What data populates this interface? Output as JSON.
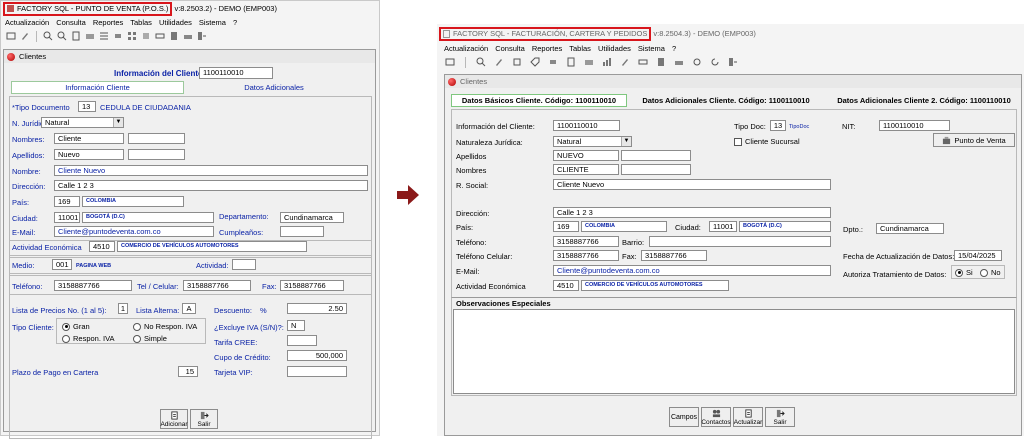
{
  "left": {
    "app_title": "FACTORY SQL - PUNTO DE VENTA (P.O.S.)",
    "version": "v:8.2503.2) - DEMO (EMP003)",
    "menu": [
      "Actualización",
      "Consulta",
      "Reportes",
      "Tablas",
      "Utilidades",
      "Sistema",
      "?"
    ],
    "child_title": "Clientes",
    "info_cliente_label": "Información del Cliente:",
    "info_cliente_value": "1100110010",
    "tabs": [
      "Información Cliente",
      "Datos Adicionales"
    ],
    "tipo_doc_label": "*Tipo Documento",
    "tipo_doc_value": "13",
    "tipo_doc_desc": "CEDULA DE CIUDADANIA",
    "n_juridica_label": "N. Jurídica:",
    "n_juridica_value": "Natural",
    "nombres_label": "Nombres:",
    "nombres_value": "Cliente",
    "apellidos_label": "Apellidos:",
    "apellidos_value": "Nuevo",
    "nombre_label": "Nombre:",
    "nombre_value": "Cliente  Nuevo",
    "direccion_label": "Dirección:",
    "direccion_value": "Calle 1 2 3",
    "pais_label": "País:",
    "pais_code": "169",
    "pais_name": "COLOMBIA",
    "ciudad_label": "Ciudad:",
    "ciudad_code": "11001",
    "ciudad_name": "BOGOTÁ (D.C)",
    "departamento_label": "Departamento:",
    "departamento_value": "Cundinamarca",
    "email_label": "E-Mail:",
    "email_value": "Cliente@puntodeventa.com.co",
    "cumpleanos_label": "Cumpleaños:",
    "actividad_label": "Actividad Económica",
    "actividad_code": "4510",
    "actividad_desc": "COMERCIO DE VEHÍCULOS AUTOMOTORES",
    "medio_label": "Medio:",
    "medio_code": "001",
    "medio_desc": "PAGINA WEB",
    "actividad2_label": "Actividad:",
    "telefono_label": "Teléfono:",
    "telefono_value": "3158887766",
    "tel_celular_label": "Tel / Celular:",
    "tel_celular_value": "3158887766",
    "fax_label": "Fax:",
    "fax_value": "3158887766",
    "lista_precios_label": "Lista de Precios No. (1 al 5):",
    "lista_precios_value": "1",
    "lista_alterna_label": "Lista Alterna:",
    "lista_alterna_value": "A",
    "descuento_label": "Descuento:",
    "descuento_pct": "%",
    "descuento_value": "2.50",
    "tipo_cliente_label": "Tipo Cliente:",
    "tipo_cliente_options": [
      "Gran",
      "No Respon. IVA",
      "Respon. IVA",
      "Simple"
    ],
    "excluye_iva_label": "¿Excluye IVA (S/N)?:",
    "excluye_iva_value": "N",
    "tarifa_cree_label": "Tarifa CREE:",
    "cupo_credito_label": "Cupo de Crédito:",
    "cupo_credito_value": "500,000",
    "plazo_label": "Plazo de Pago en Cartera",
    "plazo_value": "15",
    "tarjeta_vip_label": "Tarjeta VIP:",
    "btn_adicionar": "Adicionar",
    "btn_salir": "Salir"
  },
  "right": {
    "app_title": "FACTORY SQL - FACTURACIÓN, CARTERA Y PEDIDOS",
    "version": "v:8.2504.3) - DEMO (EMP003)",
    "menu": [
      "Actualización",
      "Consulta",
      "Reportes",
      "Tablas",
      "Utilidades",
      "Sistema",
      "?"
    ],
    "child_title": "Clientes",
    "tabs": [
      "Datos Básicos Cliente. Código: 1100110010",
      "Datos Adicionales Cliente. Código: 1100110010",
      "Datos Adicionales Cliente 2. Código: 1100110010"
    ],
    "info_cliente_label": "Información del Cliente:",
    "info_cliente_value": "1100110010",
    "tipo_doc_label": "Tipo Doc:",
    "tipo_doc_value": "13",
    "tipo_doc_link": "TipoDoc",
    "nit_label": "NIT:",
    "nit_value": "1100110010",
    "naturaleza_label": "Naturaleza Jurídica:",
    "naturaleza_value": "Natural",
    "cliente_sucursal_label": "Cliente Sucursal",
    "punto_venta_btn": "Punto de Venta",
    "apellidos_label": "Apellidos",
    "apellidos_value": "NUEVO",
    "nombres_label": "Nombres",
    "nombres_value": "CLIENTE",
    "rsocial_label": "R. Social:",
    "rsocial_value": "Cliente  Nuevo",
    "direccion_label": "Dirección:",
    "direccion_value": "Calle 1 2 3",
    "pais_label": "País:",
    "pais_code": "169",
    "pais_name": "COLOMBIA",
    "ciudad_label": "Ciudad:",
    "ciudad_code": "11001",
    "ciudad_name": "BOGOTÁ (D.C)",
    "dpto_label": "Dpto.:",
    "dpto_value": "Cundinamarca",
    "telefono_label": "Teléfono:",
    "telefono_value": "3158887766",
    "barrio_label": "Barrio:",
    "tel_celular_label": "Teléfono Celular:",
    "tel_celular_value": "3158887766",
    "fax_label": "Fax:",
    "fax_value": "3158887766",
    "fecha_act_label": "Fecha de Actualización de Datos:",
    "fecha_act_value": "15/04/2025",
    "email_label": "E-Mail:",
    "email_value": "Cliente@puntodeventa.com.co",
    "autoriza_label": "Autoriza Tratamiento de Datos:",
    "autoriza_options": [
      "Si",
      "No"
    ],
    "actividad_label": "Actividad Económica",
    "actividad_code": "4510",
    "actividad_desc": "COMERCIO DE VEHÍCULOS AUTOMOTORES",
    "observaciones_label": "Observaciones Especiales",
    "btn_campos": "Campos",
    "btn_contactos": "Contactos",
    "btn_actualizar": "Actualizar",
    "btn_salir": "Salir"
  },
  "colors": {
    "highlight_border": "#d8161c",
    "arrow": "#8b1a1a",
    "link_blue": "#0a22a6"
  }
}
